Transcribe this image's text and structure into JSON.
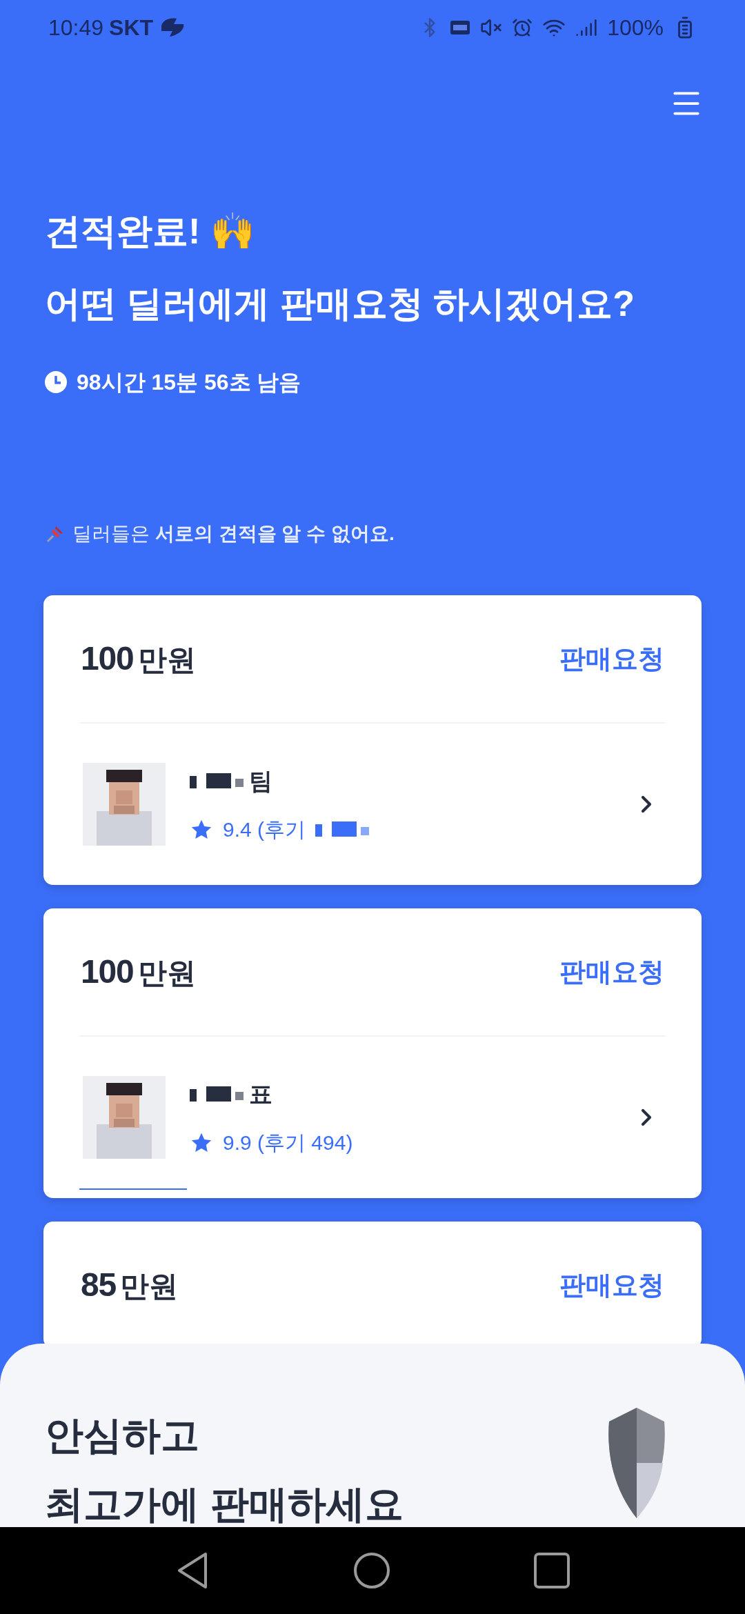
{
  "status_bar": {
    "time": "10:49",
    "carrier": "SKT",
    "battery": "100%"
  },
  "header": {
    "title_lines": [
      "견적완료! 🙌",
      "어떤 딜러에게 판매요청 하시겠어요?"
    ],
    "timer": "98시간 15분 56초 남음"
  },
  "notice": {
    "text": "딜러들은 **서로의 견적을 알 수 없어요.**"
  },
  "offers": [
    {
      "price": "100",
      "unit": "만원",
      "action": "판매요청",
      "dealer": {
        "name": "팀",
        "rating": "9.4 (후기",
        "underline": false
      }
    },
    {
      "price": "100",
      "unit": "만원",
      "action": "판매요청",
      "dealer": {
        "name": "표",
        "rating": "9.9 (후기 494)",
        "underline": true
      }
    },
    {
      "price": "85",
      "unit": "만원",
      "action": "판매요청"
    }
  ],
  "sheet": {
    "title_lines": [
      "안심하고",
      "최고가에 판매하세요"
    ]
  }
}
